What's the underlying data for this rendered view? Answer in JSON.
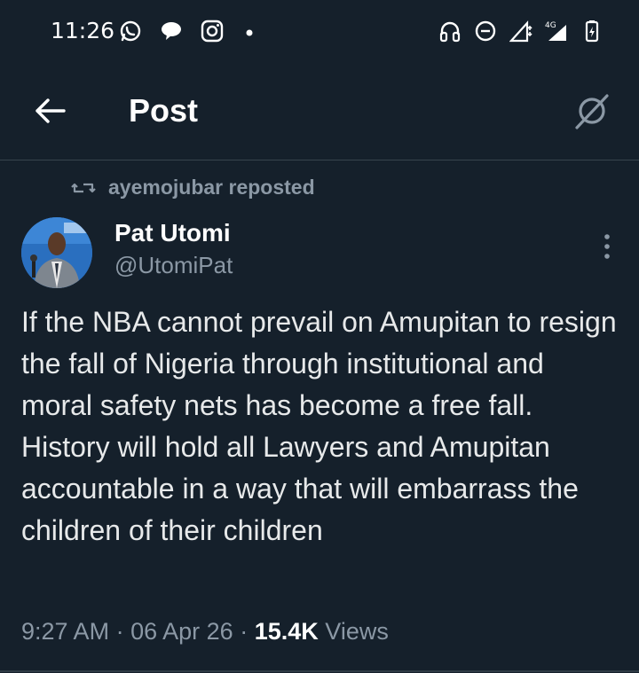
{
  "status_bar": {
    "time": "11:26",
    "network_label": "4G",
    "icons_left": [
      "whatsapp-icon",
      "chat-bubble-icon",
      "instagram-icon",
      "dot-icon"
    ],
    "icons_right": [
      "headphones-icon",
      "dnd-icon",
      "signal-icon",
      "signal-4g-icon",
      "battery-icon"
    ]
  },
  "header": {
    "title": "Post"
  },
  "post": {
    "repost_label": "ayemojubar reposted",
    "author_name": "Pat Utomi",
    "author_handle": "@UtomiPat",
    "text": "If the NBA cannot prevail on Amupitan to resign the fall of Nigeria through institutional and moral safety nets has become a free fall.  History will hold all Lawyers and Amupitan accountable in a way that will embarrass the children of their children",
    "time": "9:27 AM",
    "date": "06 Apr 26",
    "views_count": "15.4K",
    "views_label": "Views",
    "separator": "·"
  },
  "colors": {
    "background": "#15202b",
    "text_primary": "#e7e9ea",
    "text_secondary": "#8b98a5",
    "divider": "#38444d"
  }
}
